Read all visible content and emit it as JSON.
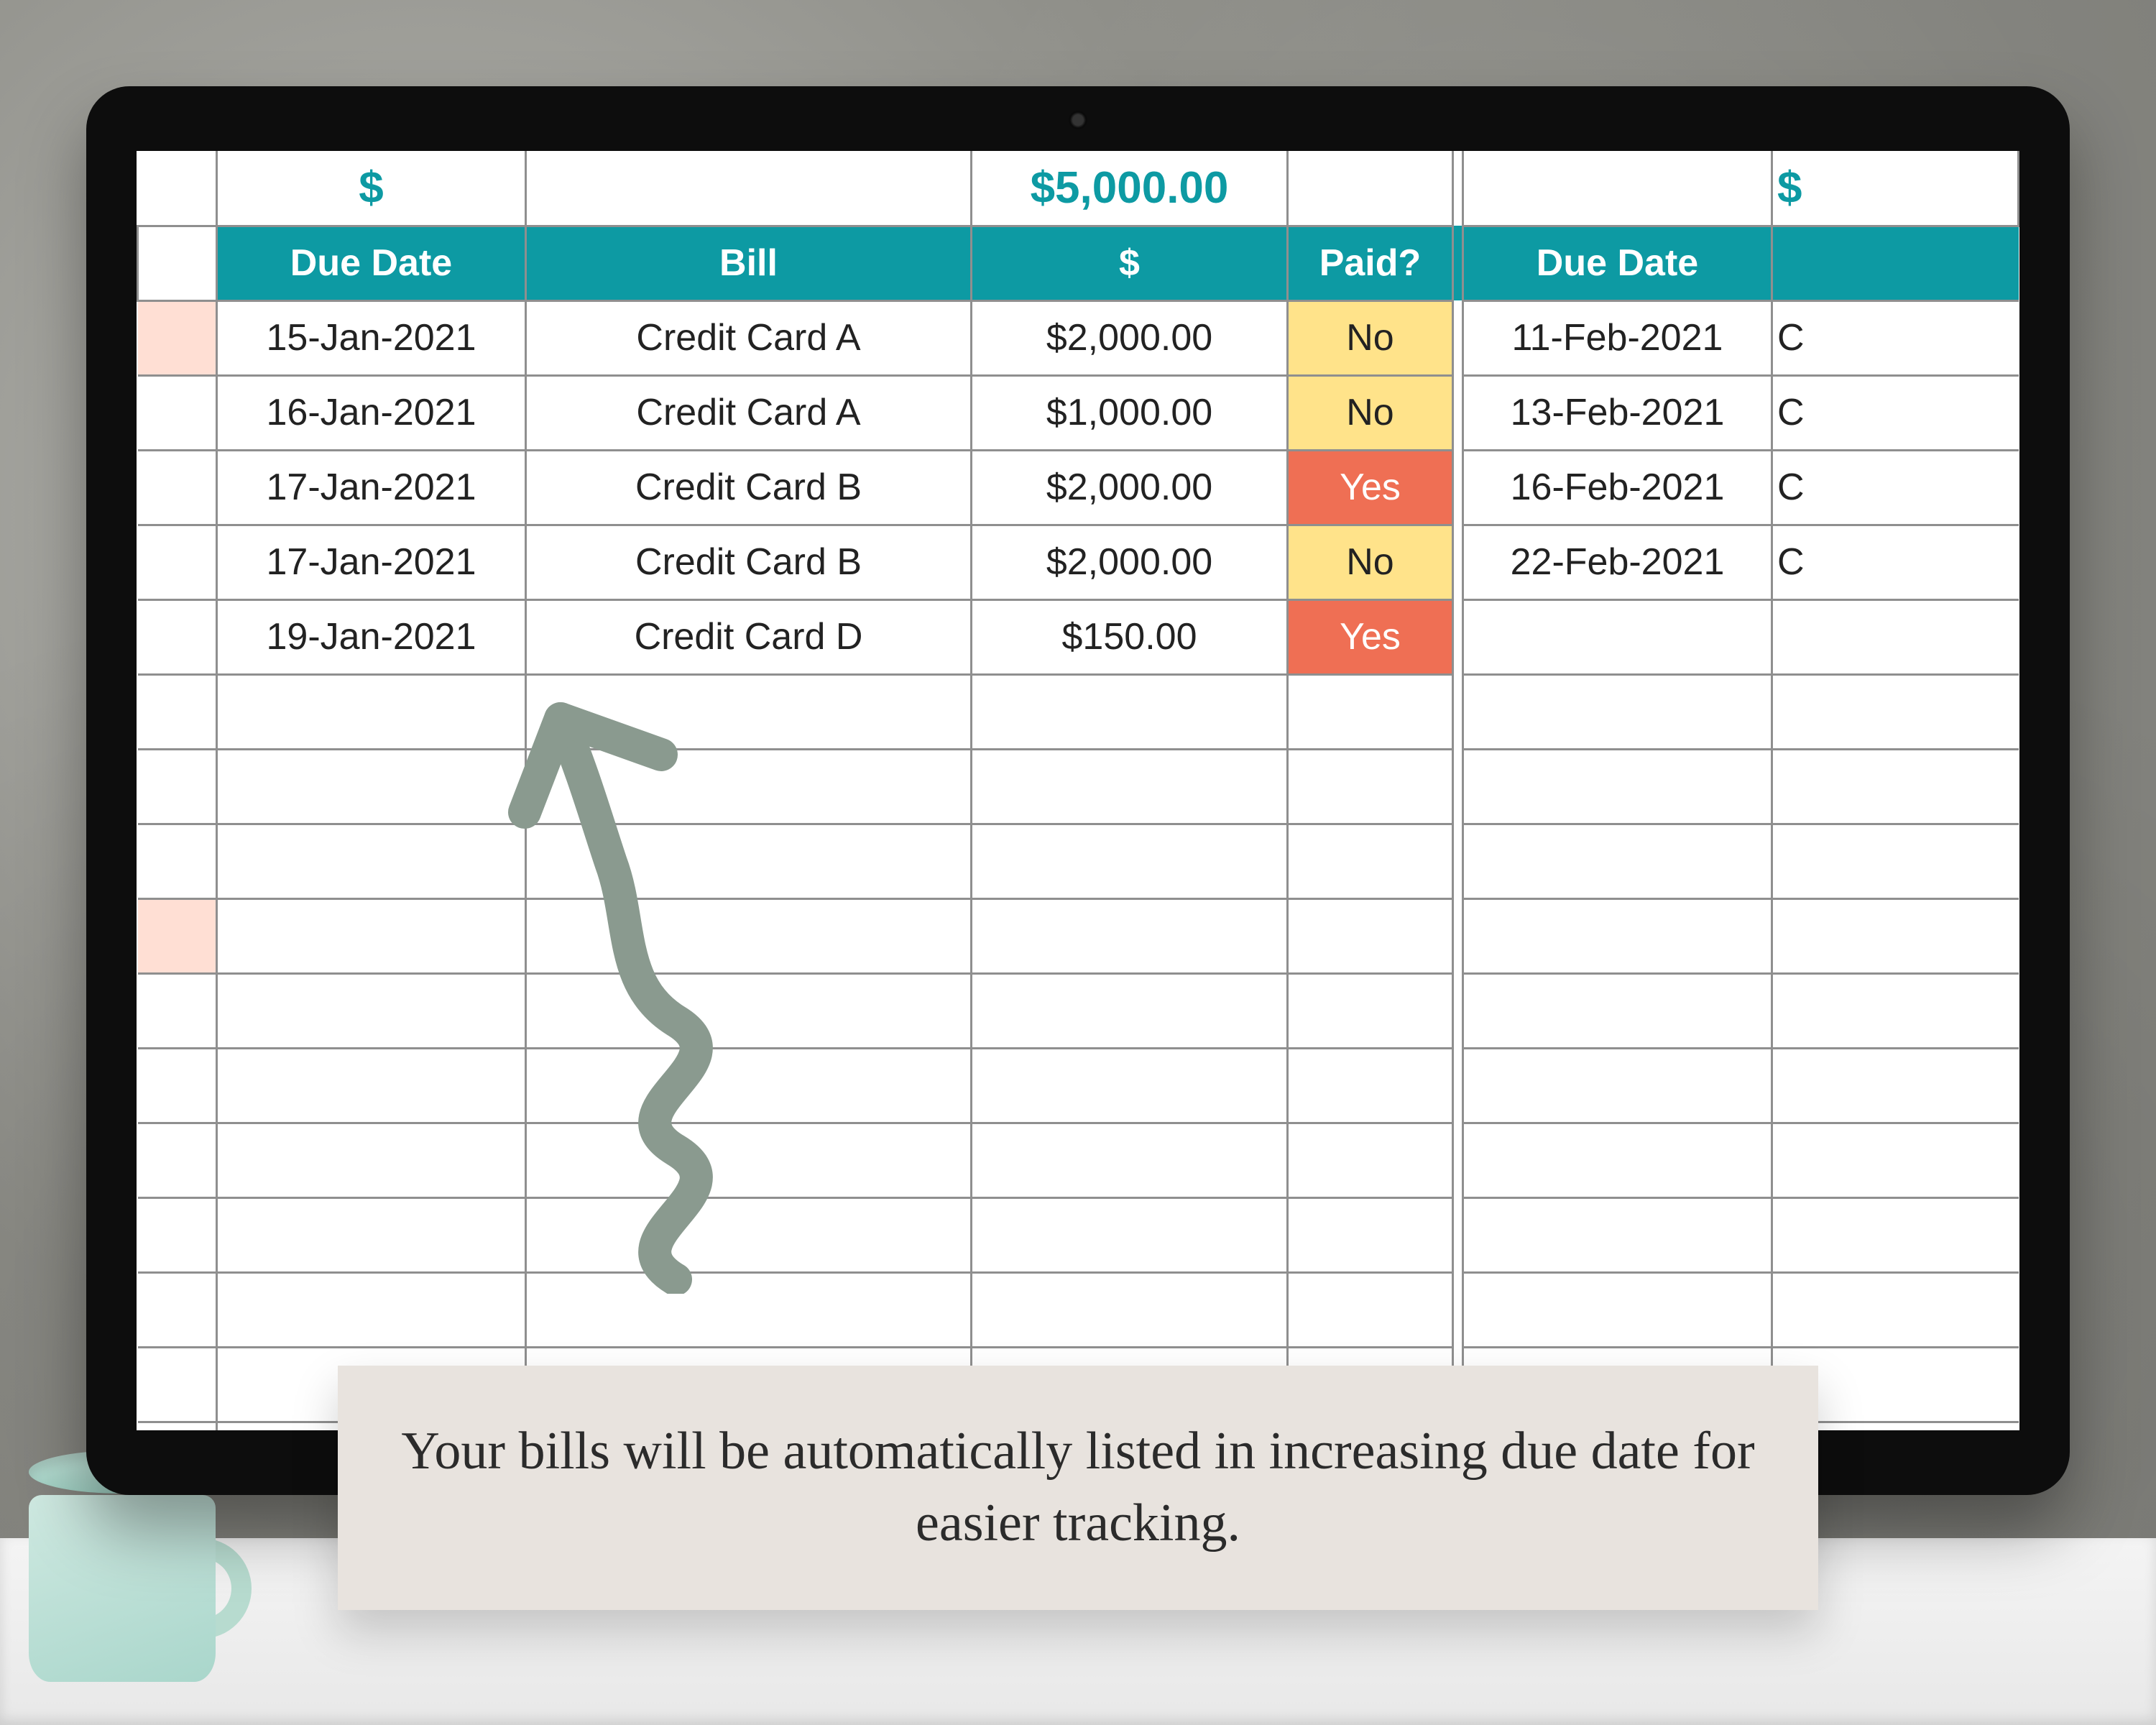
{
  "summary": {
    "left_symbol": "$",
    "total": "$5,000.00",
    "right_symbol": "$"
  },
  "headers": {
    "due": "Due Date",
    "bill": "Bill",
    "amount": "$",
    "paid": "Paid?",
    "due2": "Due Date"
  },
  "paid_labels": {
    "yes": "Yes",
    "no": "No"
  },
  "rows": [
    {
      "hl": true,
      "due": "15-Jan-2021",
      "bill": "Credit Card A",
      "amount": "$2,000.00",
      "paid": "no",
      "due2": "11-Feb-2021",
      "bill2": "C"
    },
    {
      "hl": false,
      "due": "16-Jan-2021",
      "bill": "Credit Card A",
      "amount": "$1,000.00",
      "paid": "no",
      "due2": "13-Feb-2021",
      "bill2": "C"
    },
    {
      "hl": false,
      "due": "17-Jan-2021",
      "bill": "Credit Card B",
      "amount": "$2,000.00",
      "paid": "yes",
      "due2": "16-Feb-2021",
      "bill2": "C"
    },
    {
      "hl": false,
      "due": "17-Jan-2021",
      "bill": "Credit Card B",
      "amount": "$2,000.00",
      "paid": "no",
      "due2": "22-Feb-2021",
      "bill2": "C"
    },
    {
      "hl": false,
      "due": "19-Jan-2021",
      "bill": "Credit Card D",
      "amount": "$150.00",
      "paid": "yes",
      "due2": "",
      "bill2": ""
    }
  ],
  "blank_rows": 11,
  "second_highlight_index": 8,
  "callout": "Your bills will be automatically listed in increasing due date for easier tracking.",
  "colors": {
    "teal": "#0d9aa3",
    "paid_no_bg": "#ffe38a",
    "paid_yes_bg": "#ef6f54",
    "row_hl_bg": "#ffdfd4",
    "arrow": "#8a9a8f"
  }
}
